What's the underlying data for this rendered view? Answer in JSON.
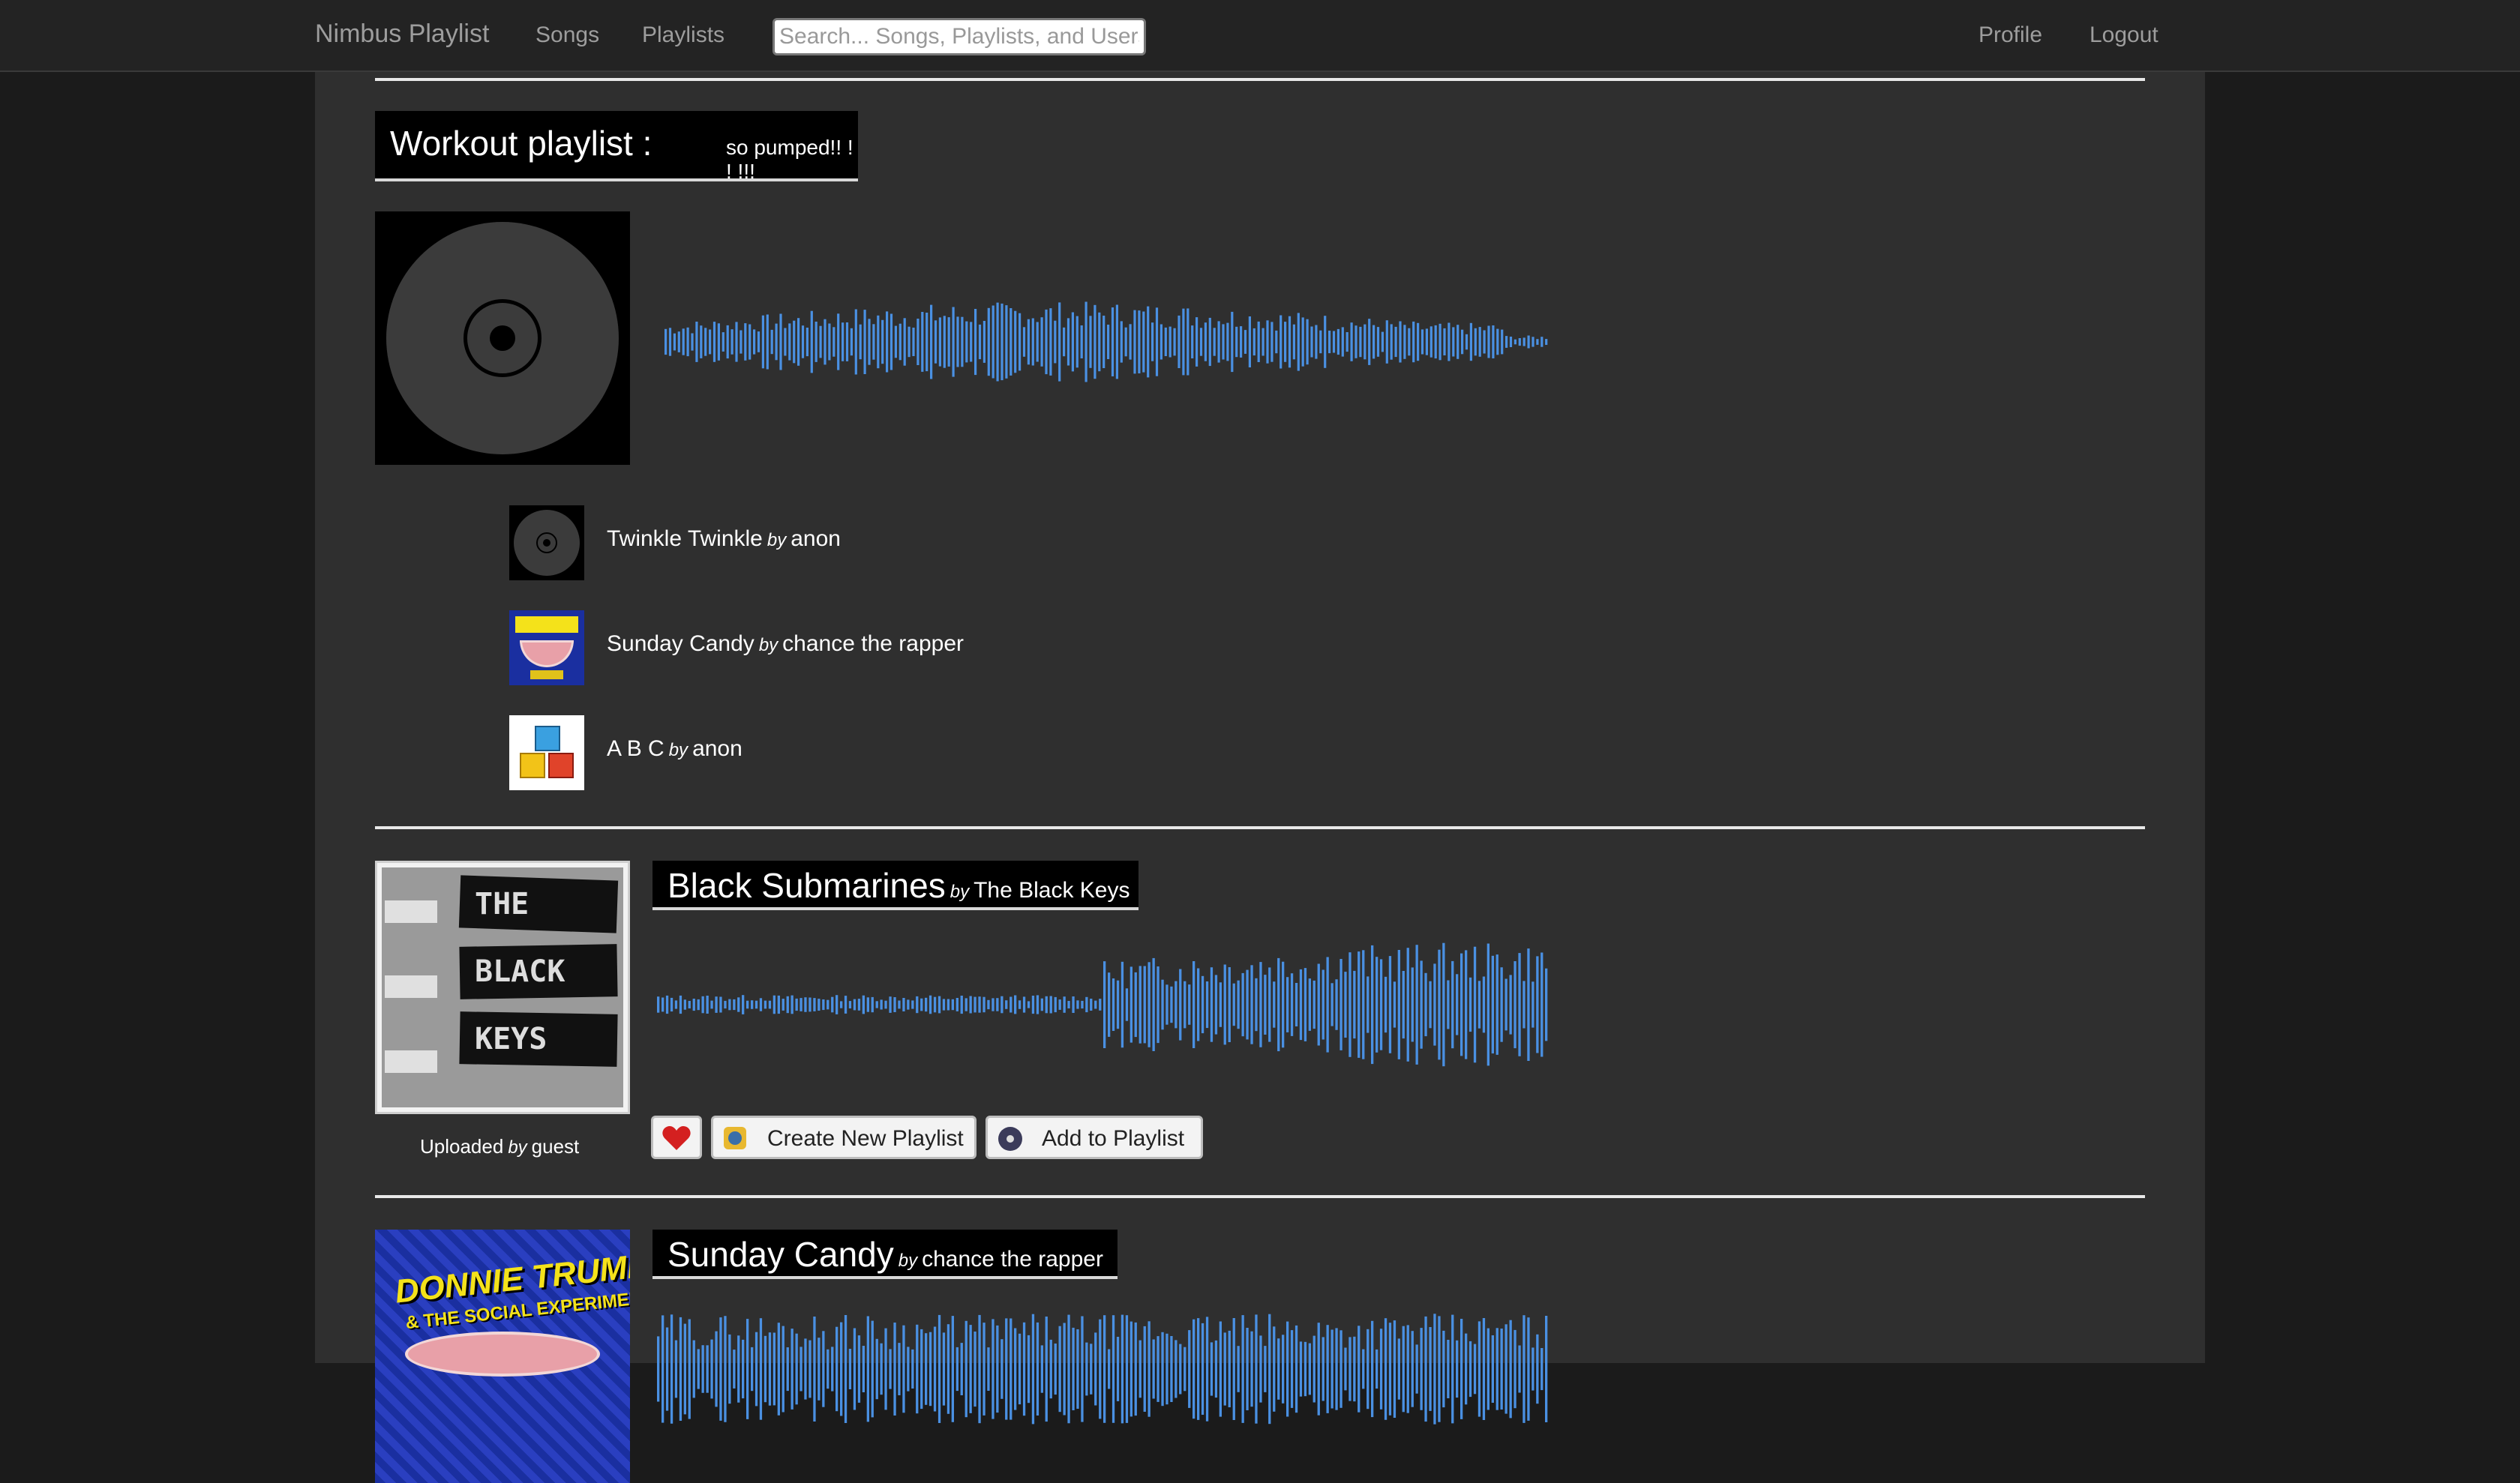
{
  "nav": {
    "brand": "Nimbus Playlist",
    "links": [
      "Songs",
      "Playlists"
    ],
    "search_placeholder": "Search... Songs, Playlists, and Users",
    "right_links": [
      "Profile",
      "Logout"
    ]
  },
  "playlist": {
    "title": "Workout playlist :",
    "description": "so pumped!! ! ! !!!",
    "cover_icon": "disc-icon",
    "tracks": [
      {
        "title": "Twinkle Twinkle",
        "by": "by",
        "artist": "anon",
        "thumb": "disc-icon"
      },
      {
        "title": "Sunday Candy",
        "by": "by",
        "artist": "chance the rapper",
        "thumb": "album-art-donnie-trumpet"
      },
      {
        "title": "A B C",
        "by": "by",
        "artist": "anon",
        "thumb": "abc-blocks-icon"
      }
    ]
  },
  "songs": [
    {
      "title": "Black Submarines",
      "by": "by",
      "artist": "The Black Keys",
      "cover_text": [
        "THE",
        "BLACK",
        "KEYS"
      ],
      "uploaded_label": "Uploaded",
      "uploaded_by": "by",
      "uploader": "guest",
      "buttons": {
        "like_icon": "heart-icon",
        "create": "Create New Playlist",
        "add": "Add to Playlist"
      }
    },
    {
      "title": "Sunday Candy",
      "by": "by",
      "artist": "chance the rapper",
      "cover_text": [
        "DONNIE TRUMPET",
        "& THE SOCIAL EXPERIMENT"
      ]
    }
  ],
  "colors": {
    "waveform": "#4a90e2",
    "page": "#2f2f2f",
    "nav": "#232323"
  }
}
